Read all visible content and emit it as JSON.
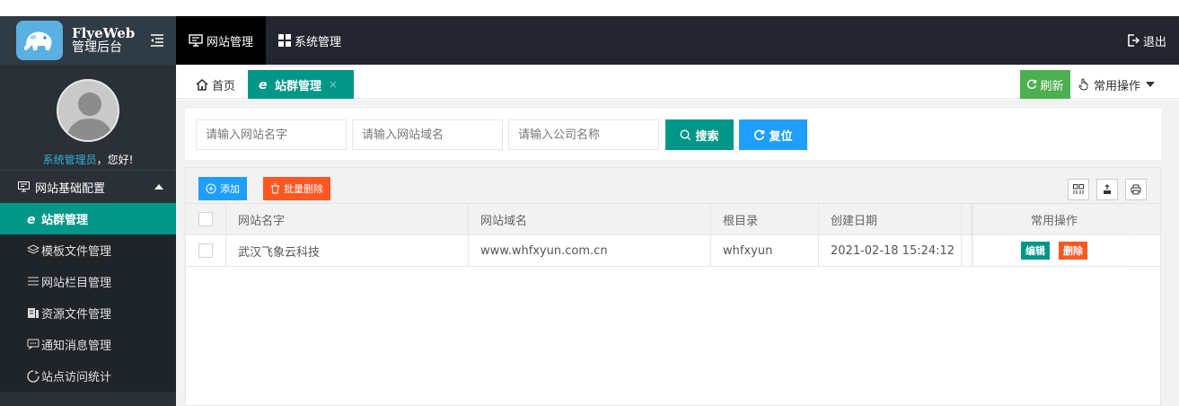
{
  "header": {
    "logo_title": "FlyeWeb",
    "logo_subtitle": "管理后台",
    "nav": [
      {
        "label": "网站管理",
        "active": true,
        "icon": "monitor-icon"
      },
      {
        "label": "系统管理",
        "active": false,
        "icon": "grid-icon"
      }
    ],
    "logout_label": "退出"
  },
  "sidebar": {
    "user_role": "系统管理员",
    "greeting": "，您好!",
    "group_label": "网站基础配置",
    "items": [
      {
        "label": "站群管理",
        "active": true,
        "icon": "ie-icon"
      },
      {
        "label": "模板文件管理",
        "active": false,
        "icon": "layers-icon"
      },
      {
        "label": "网站栏目管理",
        "active": false,
        "icon": "list-icon"
      },
      {
        "label": "资源文件管理",
        "active": false,
        "icon": "file-icon"
      },
      {
        "label": "通知消息管理",
        "active": false,
        "icon": "message-icon"
      },
      {
        "label": "站点访问统计",
        "active": false,
        "icon": "stats-icon"
      }
    ]
  },
  "tabs": {
    "home_label": "首页",
    "site_label": "站群管理",
    "close_glyph": "×",
    "refresh_label": "刷新",
    "common_ops_label": "常用操作"
  },
  "search": {
    "site_name_placeholder": "请输入网站名字",
    "site_domain_placeholder": "请输入网站域名",
    "company_placeholder": "请输入公司名称",
    "search_label": "搜索",
    "reset_label": "复位"
  },
  "toolbar": {
    "add_label": "添加",
    "batch_delete_label": "批量删除"
  },
  "table": {
    "headers": [
      "网站名字",
      "网站域名",
      "根目录",
      "创建日期",
      "常用操作"
    ],
    "rows": [
      {
        "name": "武汉飞象云科技",
        "domain": "www.whfxyun.com.cn",
        "root": "whfxyun",
        "created": "2021-02-18 15:24:12",
        "edit_label": "编辑",
        "delete_label": "删除"
      }
    ]
  },
  "colors": {
    "primary_green": "#009688",
    "blue": "#1e9fff",
    "orange": "#ff5722",
    "refresh_green": "#4caf50",
    "header_dark": "#23262e",
    "sidebar_dark": "#2a3036"
  }
}
